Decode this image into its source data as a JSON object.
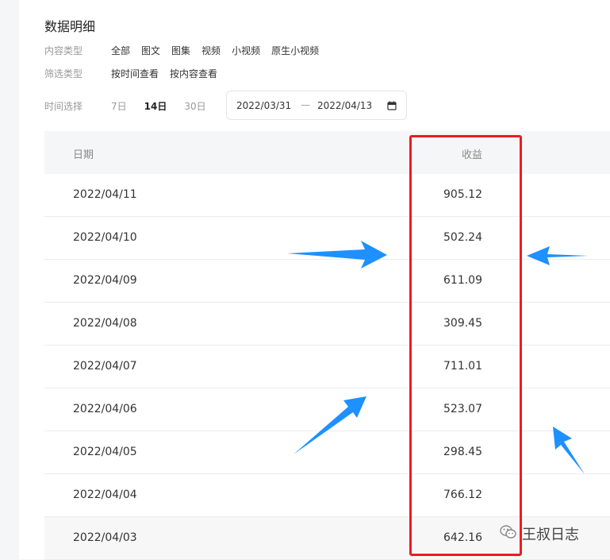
{
  "page": {
    "title": "数据明细"
  },
  "filters": {
    "content_type": {
      "label": "内容类型",
      "options": [
        "全部",
        "图文",
        "图集",
        "视频",
        "小视频",
        "原生小视频"
      ]
    },
    "filter_type": {
      "label": "筛选类型",
      "options": [
        "按时间查看",
        "按内容查看"
      ]
    },
    "time": {
      "label": "时间选择",
      "options": [
        "7日",
        "14日",
        "30日"
      ],
      "selected": "14日",
      "range_start": "2022/03/31",
      "range_sep": "—",
      "range_end": "2022/04/13"
    }
  },
  "table": {
    "headers": {
      "date": "日期",
      "income": "收益"
    },
    "rows": [
      {
        "date": "2022/04/11",
        "income": "905.12"
      },
      {
        "date": "2022/04/10",
        "income": "502.24"
      },
      {
        "date": "2022/04/09",
        "income": "611.09"
      },
      {
        "date": "2022/04/08",
        "income": "309.45"
      },
      {
        "date": "2022/04/07",
        "income": "711.01"
      },
      {
        "date": "2022/04/06",
        "income": "523.07"
      },
      {
        "date": "2022/04/05",
        "income": "298.45"
      },
      {
        "date": "2022/04/04",
        "income": "766.12"
      },
      {
        "date": "2022/04/03",
        "income": "642.16"
      }
    ]
  },
  "annotations": {
    "highlight_color": "#ee1b22",
    "arrow_color": "#1e90ff"
  },
  "watermark": {
    "text": "王叔日志",
    "icon": "wechat-icon"
  }
}
